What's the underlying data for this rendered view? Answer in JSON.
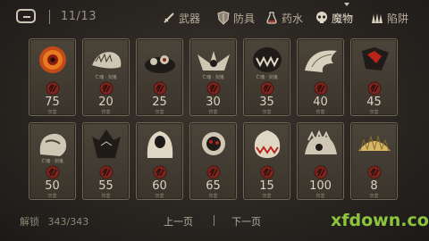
{
  "header": {
    "counter": "11/13",
    "tabs": [
      {
        "label": "武器",
        "icon": "sword-icon"
      },
      {
        "label": "防具",
        "icon": "shield-icon"
      },
      {
        "label": "药水",
        "icon": "potion-icon"
      },
      {
        "label": "魔物",
        "icon": "monster-skull-icon",
        "active": true
      },
      {
        "label": "陷阱",
        "icon": "trap-spikes-icon"
      }
    ]
  },
  "cards": [
    {
      "value": "75",
      "caption": "",
      "sub": "伤害",
      "art": "sun-eye"
    },
    {
      "value": "20",
      "caption": "亡魂 · 剑鬼",
      "sub": "伤害",
      "art": "bone-beast"
    },
    {
      "value": "25",
      "caption": "",
      "sub": "伤害",
      "art": "shadow-slime"
    },
    {
      "value": "30",
      "caption": "亡魂 · 剑鬼",
      "sub": "伤害",
      "art": "winged-bones"
    },
    {
      "value": "35",
      "caption": "亡魂 · 剑鬼",
      "sub": "伤害",
      "art": "maw-beast"
    },
    {
      "value": "40",
      "caption": "",
      "sub": "伤害",
      "art": "feather-wing"
    },
    {
      "value": "45",
      "caption": "",
      "sub": "伤害",
      "art": "red-crystal"
    },
    {
      "value": "50",
      "caption": "亡魂 · 剑鬼",
      "sub": "伤害",
      "art": "stone-golem"
    },
    {
      "value": "55",
      "caption": "",
      "sub": "伤害",
      "art": "dark-knight"
    },
    {
      "value": "60",
      "caption": "",
      "sub": "伤害",
      "art": "hooded-wraith"
    },
    {
      "value": "65",
      "caption": "",
      "sub": "伤害",
      "art": "spiked-eye"
    },
    {
      "value": "15",
      "caption": "",
      "sub": "伤害",
      "art": "fang-egg"
    },
    {
      "value": "100",
      "caption": "",
      "sub": "伤害",
      "art": "crowned-beast"
    },
    {
      "value": "8",
      "caption": "",
      "sub": "伤害",
      "art": "spike-fan"
    }
  ],
  "footer": {
    "unlock_label": "解锁",
    "unlock_count": "343/343",
    "prev_page": "上一页",
    "next_page": "下一页"
  },
  "watermark": "xfdown.com",
  "colors": {
    "seal_red": "#8c2a22",
    "accent_green": "#8cc63f"
  }
}
